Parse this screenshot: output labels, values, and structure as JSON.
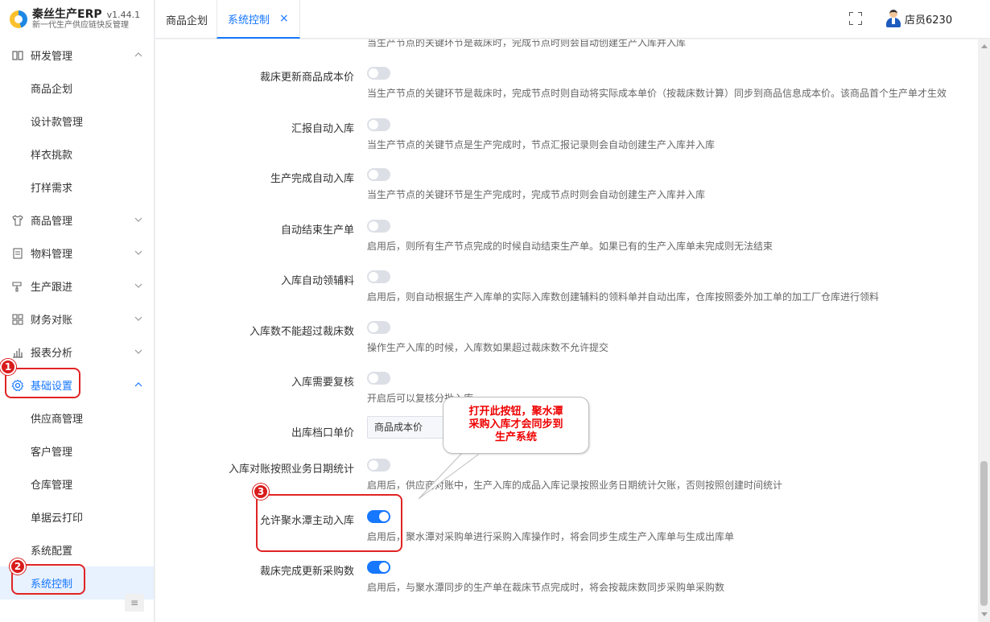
{
  "app": {
    "name": "秦丝生产ERP",
    "version": "v1.44.1",
    "subtitle": "新一代生产供应链快反管理"
  },
  "sidebar": {
    "groups": [
      {
        "label": "研发管理",
        "icon": "book-icon",
        "expanded": true,
        "items": [
          "商品企划",
          "设计款管理",
          "样衣挑款",
          "打样需求"
        ]
      },
      {
        "label": "商品管理",
        "icon": "shirt-icon",
        "expanded": false
      },
      {
        "label": "物料管理",
        "icon": "document-icon",
        "expanded": false
      },
      {
        "label": "生产跟进",
        "icon": "brush-icon",
        "expanded": false
      },
      {
        "label": "财务对账",
        "icon": "grid-icon",
        "expanded": false
      },
      {
        "label": "报表分析",
        "icon": "bar-chart-icon",
        "expanded": false
      },
      {
        "label": "基础设置",
        "icon": "gear-icon",
        "expanded": true,
        "items": [
          "供应商管理",
          "客户管理",
          "仓库管理",
          "单据云打印",
          "系统配置",
          "系统控制"
        ]
      }
    ],
    "active_item": "系统控制"
  },
  "header": {
    "tabs": [
      {
        "label": "商品企划",
        "active": false
      },
      {
        "label": "系统控制",
        "active": true,
        "close": "×"
      }
    ],
    "user": "店员6230"
  },
  "settings": {
    "top_cut_desc": "当生产节点的关键环节是裁床时，完成节点时则会自动创建生产入库并入库",
    "rows": [
      {
        "label": "裁床更新商品成本价",
        "on": false,
        "desc": "当生产节点的关键环节是裁床时，完成节点时则自动将实际成本单价（按裁床数计算）同步到商品信息成本价。该商品首个生产单才生效"
      },
      {
        "label": "汇报自动入库",
        "on": false,
        "desc": "当生产节点的关键节点是生产完成时，节点汇报记录则会自动创建生产入库并入库"
      },
      {
        "label": "生产完成自动入库",
        "on": false,
        "desc": "当生产节点的关键环节是生产完成时，完成节点时则会自动创建生产入库并入库"
      },
      {
        "label": "自动结束生产单",
        "on": false,
        "desc": "启用后，则所有生产节点完成的时候自动结束生产单。如果已有的生产入库单未完成则无法结束"
      },
      {
        "label": "入库自动领辅料",
        "on": false,
        "desc": "启用后，则自动根据生产入库单的实际入库数创建辅料的领料单并自动出库，仓库按照委外加工单的加工厂仓库进行领料"
      },
      {
        "label": "入库数不能超过裁床数",
        "on": false,
        "desc": "操作生产入库的时候，入库数如果超过裁床数不允许提交"
      },
      {
        "label": "入库需要复核",
        "on": false,
        "desc": "开启后可以复核分批入库"
      },
      {
        "label": "出库档口单价",
        "select": "商品成本价"
      },
      {
        "label": "入库对账按照业务日期统计",
        "on": false,
        "desc": "启用后，供应商对账中，生产入库的成品入库记录按照业务日期统计欠账，否则按照创建时间统计"
      },
      {
        "label": "允许聚水潭主动入库",
        "on": true,
        "desc": "启用后，聚水潭对采购单进行采购入库操作时，将会同步生成生产入库单与生成出库单"
      },
      {
        "label": "裁床完成更新采购数",
        "on": true,
        "desc": "启用后，与聚水潭同步的生产单在裁床节点完成时，将会按裁床数同步采购单采购数"
      }
    ]
  },
  "annotations": {
    "markers": [
      "1",
      "2",
      "3"
    ],
    "callout_lines": [
      "打开此按钮，聚水潭",
      "采购入库才会同步到",
      "生产系统"
    ],
    "color": "#e02424"
  }
}
